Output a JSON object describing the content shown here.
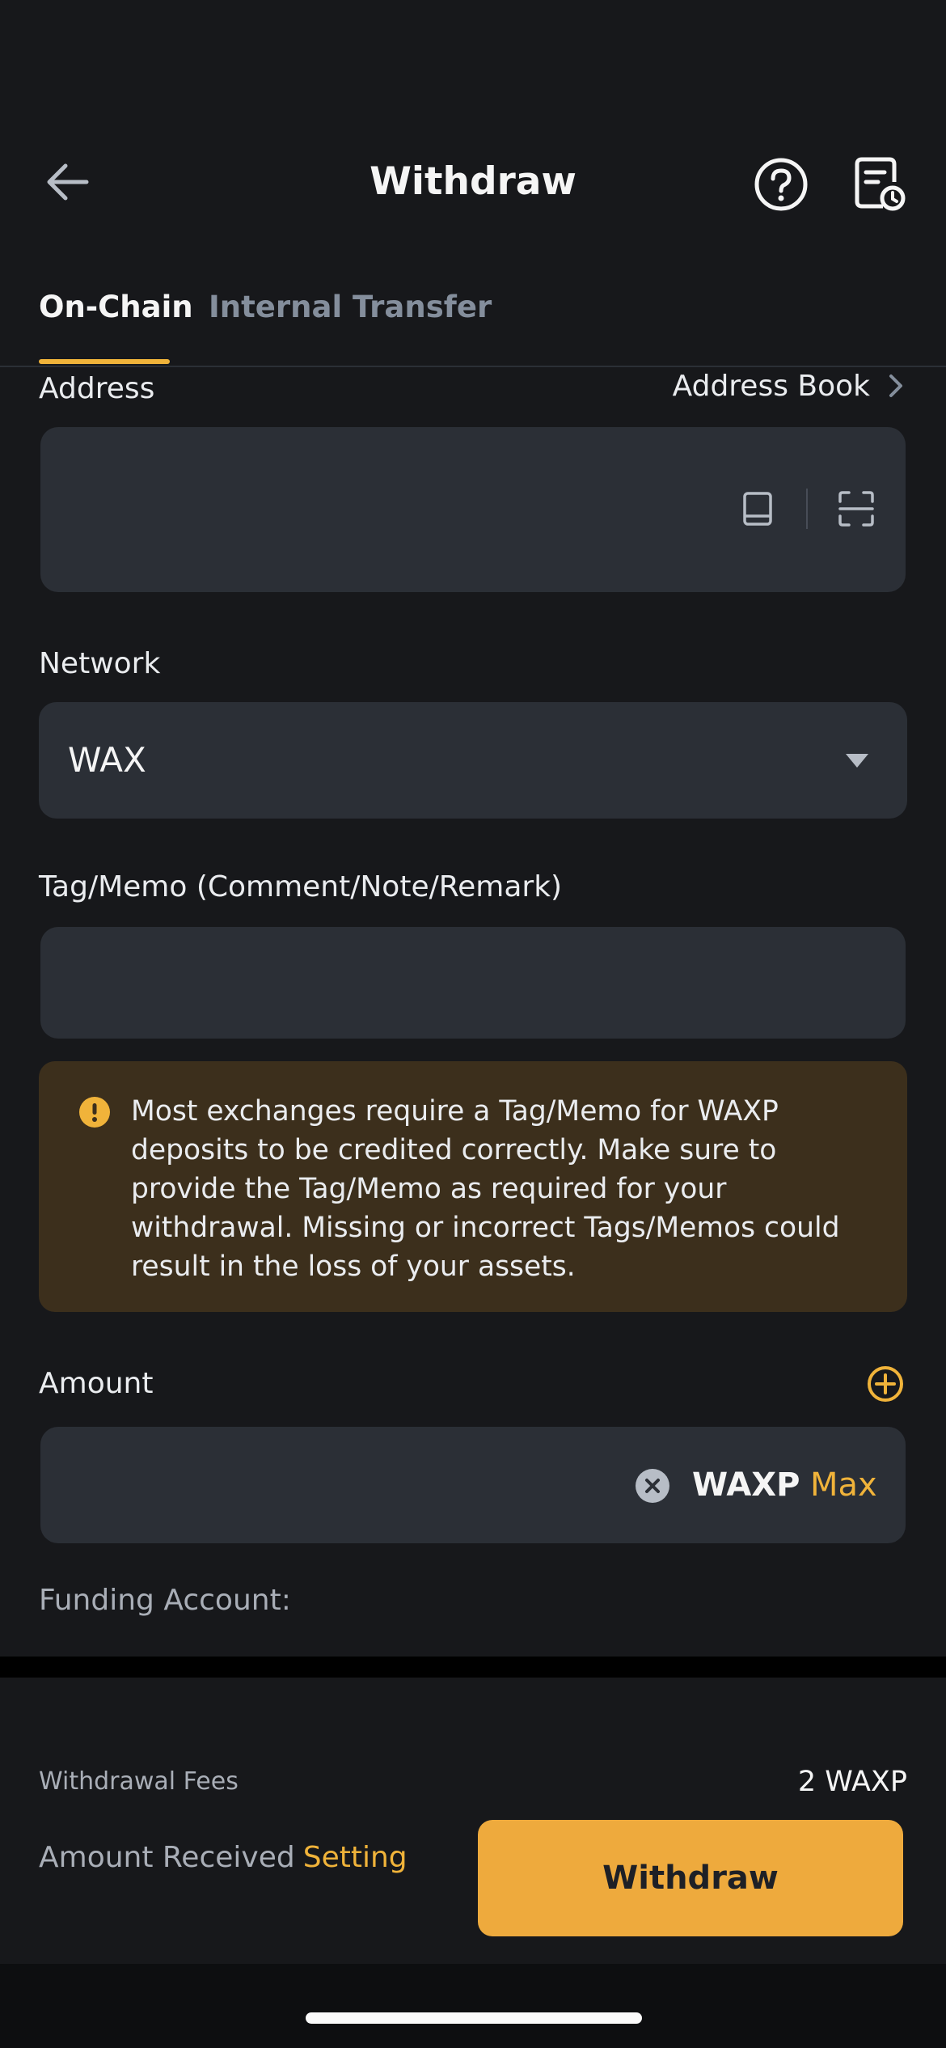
{
  "header": {
    "title": "Withdraw",
    "back_icon": "arrow-left-icon",
    "help_icon": "question-circle-icon",
    "history_icon": "document-clock-icon"
  },
  "tabs": [
    {
      "label": "On-Chain",
      "active": true
    },
    {
      "label": "Internal Transfer",
      "active": false
    }
  ],
  "address": {
    "label": "Address",
    "address_book_label": "Address Book",
    "value": ""
  },
  "network": {
    "label": "Network",
    "selected": "WAX"
  },
  "memo": {
    "label": "Tag/Memo (Comment/Note/Remark)",
    "value": ""
  },
  "warning": {
    "text": "Most exchanges require a Tag/Memo for WAXP deposits to be credited correctly. Make sure to provide the Tag/Memo as required for your withdrawal. Missing or incorrect Tags/Memos could result in the loss of your assets."
  },
  "amount": {
    "label": "Amount",
    "value": "",
    "unit": "WAXP",
    "max_label": "Max"
  },
  "funding": {
    "label": "Funding Account:"
  },
  "summary": {
    "fees_label": "Withdrawal Fees",
    "fees_value": "2 WAXP",
    "received_label": "Amount Received",
    "setting_label": "Setting"
  },
  "submit": {
    "label": "Withdraw"
  },
  "colors": {
    "accent": "#F0B33A",
    "background": "#17181B",
    "input": "#2B2F36",
    "warning_bg": "#3C2F1C"
  }
}
